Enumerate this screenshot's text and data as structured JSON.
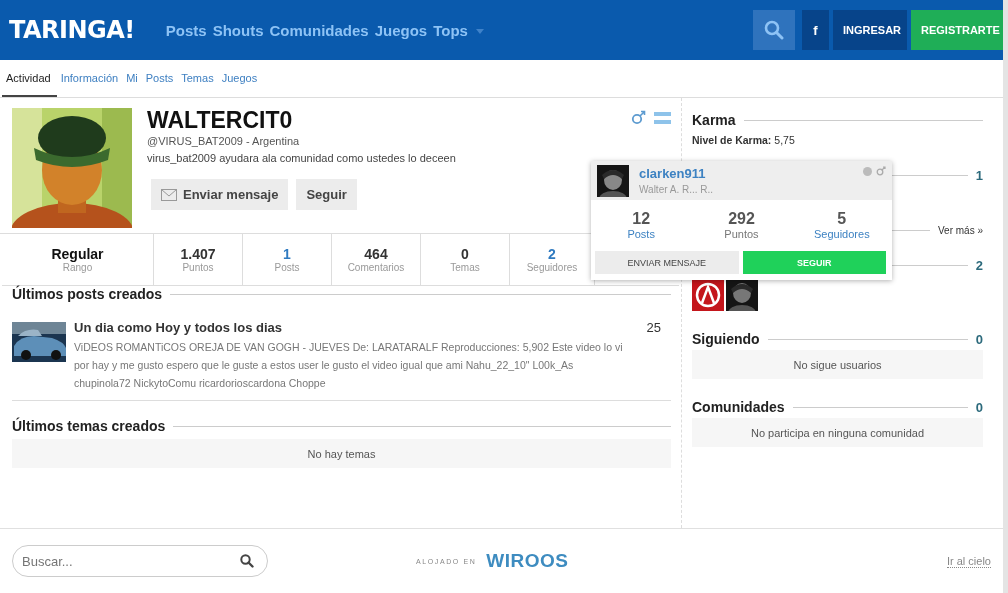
{
  "header": {
    "logo": "TARINGA!",
    "nav": [
      "Posts",
      "Shouts",
      "Comunidades",
      "Juegos",
      "Tops"
    ],
    "facebook": "f",
    "login": "INGRESAR",
    "register": "REGISTRARTE"
  },
  "tabs": [
    {
      "label": "Actividad",
      "selected": true
    },
    {
      "label": "Información",
      "selected": false
    },
    {
      "label": "Mi",
      "selected": false
    },
    {
      "label": "Posts",
      "selected": false
    },
    {
      "label": "Temas",
      "selected": false
    },
    {
      "label": "Juegos",
      "selected": false
    }
  ],
  "profile": {
    "name": "WALTERCIT0",
    "handle": "@VIRUS_BAT2009 - Argentina",
    "bio": "virus_bat2009 ayudara ala comunidad como ustedes lo deceen",
    "message_button": "Enviar mensaje",
    "follow_button": "Seguir"
  },
  "stats": [
    {
      "value": "Regular",
      "label": "Rango",
      "kind": "rank"
    },
    {
      "value": "1.407",
      "label": "Puntos",
      "kind": "plain"
    },
    {
      "value": "1",
      "label": "Posts",
      "kind": "link"
    },
    {
      "value": "464",
      "label": "Comentarios",
      "kind": "plain"
    },
    {
      "value": "0",
      "label": "Temas",
      "kind": "plain"
    },
    {
      "value": "2",
      "label": "Seguidores",
      "kind": "link"
    }
  ],
  "latest_posts": {
    "title": "Últimos posts creados",
    "posts": [
      {
        "title": "Un dia como Hoy y todos los dias",
        "excerpt": "ViDEOS ROMANTiCOS OREJA DE VAN GOGH - JUEVES De: LARATARALF Reproducciones: 5,902 Este video lo vi por hay y me gusto espero que le guste a estos user le gusto el video igual que ami Nahu_22_10\" L00k_As chupinola72 NickytoComu ricardorioscardona Choppe",
        "score": "25"
      }
    ]
  },
  "latest_topics": {
    "title": "Últimos temas creados",
    "empty": "No hay temas"
  },
  "footer": {
    "search_placeholder": "Buscar...",
    "hosted_label": "ALOJADO EN",
    "host_logo": "WIROOS",
    "to_top": "Ir al cielo"
  },
  "sidebar": {
    "karma": {
      "title": "Karma",
      "text": "**Nivel de Karma:** 5,75"
    },
    "medals": {
      "count": "1",
      "more": "Ver más »"
    },
    "followers": {
      "count": "2"
    },
    "following": {
      "title": "Siguiendo",
      "count": "0",
      "empty": "No sigue usuarios"
    },
    "communities": {
      "title": "Comunidades",
      "count": "0",
      "empty": "No participa en ninguna comunidad"
    }
  },
  "hover_card": {
    "username": "clarken911",
    "fullname": "Walter A. R... R..",
    "online": false,
    "stats": [
      {
        "value": "12",
        "label": "Posts",
        "kind": "link"
      },
      {
        "value": "292",
        "label": "Puntos",
        "kind": "plain"
      },
      {
        "value": "5",
        "label": "Seguidores",
        "kind": "link"
      }
    ],
    "message_button": "ENVIAR MENSAJE",
    "follow_button": "SEGUIR"
  }
}
